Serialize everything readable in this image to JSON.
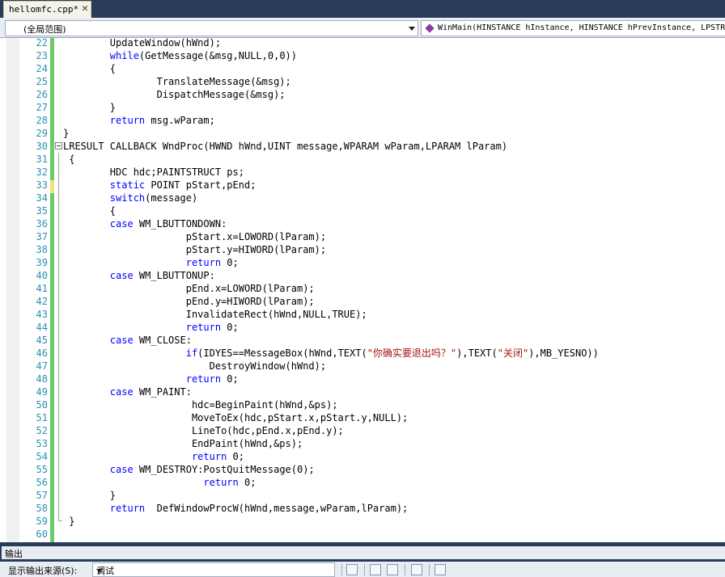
{
  "tab": {
    "title": "hellomfc.cpp*",
    "close": "✕"
  },
  "navbar": {
    "scope": "(全局范围)",
    "function": "WinMain(HINSTANCE hInstance, HINSTANCE hPrevInstance, LPSTR"
  },
  "lines": [
    {
      "n": "22",
      "t": "        UpdateWindow(hWnd);"
    },
    {
      "n": "23",
      "t": "        while(GetMessage(&msg,NULL,0,0))"
    },
    {
      "n": "24",
      "t": "        {"
    },
    {
      "n": "25",
      "t": "                TranslateMessage(&msg);"
    },
    {
      "n": "26",
      "t": "                DispatchMessage(&msg);"
    },
    {
      "n": "27",
      "t": "        }"
    },
    {
      "n": "28",
      "t": "        return msg.wParam;"
    },
    {
      "n": "29",
      "t": "}"
    },
    {
      "n": "30",
      "t": "LRESULT CALLBACK WndProc(HWND hWnd,UINT message,WPARAM wParam,LPARAM lParam)"
    },
    {
      "n": "31",
      "t": " {"
    },
    {
      "n": "32",
      "t": "        HDC hdc;PAINTSTRUCT ps;"
    },
    {
      "n": "33",
      "t": "        static POINT pStart,pEnd;"
    },
    {
      "n": "34",
      "t": "        switch(message)"
    },
    {
      "n": "35",
      "t": "        {"
    },
    {
      "n": "36",
      "t": "        case WM_LBUTTONDOWN:"
    },
    {
      "n": "37",
      "t": "                     pStart.x=LOWORD(lParam);"
    },
    {
      "n": "38",
      "t": "                     pStart.y=HIWORD(lParam);"
    },
    {
      "n": "39",
      "t": "                     return 0;"
    },
    {
      "n": "40",
      "t": "        case WM_LBUTTONUP:"
    },
    {
      "n": "41",
      "t": "                     pEnd.x=LOWORD(lParam);"
    },
    {
      "n": "42",
      "t": "                     pEnd.y=HIWORD(lParam);"
    },
    {
      "n": "43",
      "t": "                     InvalidateRect(hWnd,NULL,TRUE);"
    },
    {
      "n": "44",
      "t": "                     return 0;"
    },
    {
      "n": "45",
      "t": "        case WM_CLOSE:"
    },
    {
      "n": "46",
      "t": "                     if(IDYES==MessageBox(hWnd,TEXT(\"你确实要退出吗？\"),TEXT(\"关闭\"),MB_YESNO))"
    },
    {
      "n": "47",
      "t": "                         DestroyWindow(hWnd);"
    },
    {
      "n": "48",
      "t": "                     return 0;"
    },
    {
      "n": "49",
      "t": "        case WM_PAINT:"
    },
    {
      "n": "50",
      "t": "                      hdc=BeginPaint(hWnd,&ps);"
    },
    {
      "n": "51",
      "t": "                      MoveToEx(hdc,pStart.x,pStart.y,NULL);"
    },
    {
      "n": "52",
      "t": "                      LineTo(hdc,pEnd.x,pEnd.y);"
    },
    {
      "n": "53",
      "t": "                      EndPaint(hWnd,&ps);"
    },
    {
      "n": "54",
      "t": "                      return 0;"
    },
    {
      "n": "55",
      "t": "        case WM_DESTROY:PostQuitMessage(0);"
    },
    {
      "n": "56",
      "t": "                        return 0;"
    },
    {
      "n": "57",
      "t": "        }"
    },
    {
      "n": "58",
      "t": "        return  DefWindowProcW(hWnd,message,wParam,lParam);"
    },
    {
      "n": "59",
      "t": " }"
    },
    {
      "n": "60",
      "t": ""
    }
  ],
  "output": {
    "title": "输出",
    "source_label": "显示输出来源(S):",
    "source_value": "调试"
  },
  "colors": {
    "keyword": "#0000ff",
    "string": "#a31515",
    "line_number": "#2b91af",
    "changed": "#6ac96a"
  }
}
